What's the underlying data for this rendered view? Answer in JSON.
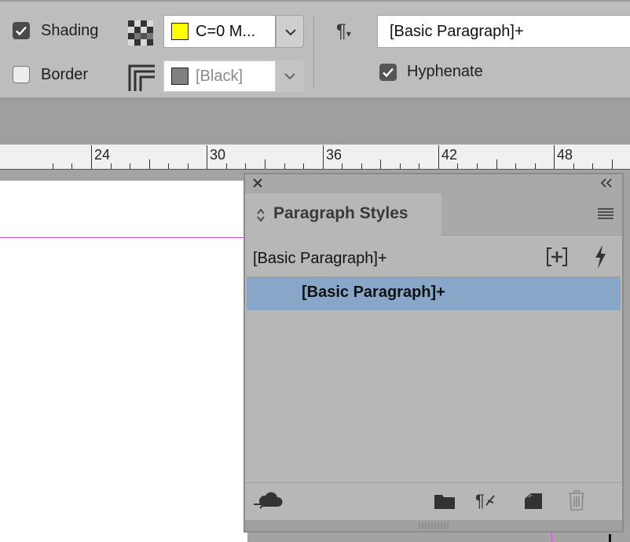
{
  "control_bar": {
    "shading": {
      "label": "Shading",
      "checked": true,
      "swatch_value": "C=0 M...",
      "swatch_color": "#ffff00"
    },
    "border": {
      "label": "Border",
      "checked": false,
      "swatch_value": "[Black]",
      "swatch_color": "#808080"
    },
    "paragraph_style_value": "[Basic Paragraph]+",
    "hyphenate": {
      "label": "Hyphenate",
      "checked": true
    }
  },
  "ruler": {
    "labels": [
      "24",
      "30",
      "36",
      "42",
      "48"
    ]
  },
  "panel": {
    "title": "Paragraph Styles",
    "current_style": "[Basic Paragraph]+",
    "styles": [
      {
        "label": "[Basic Paragraph]+",
        "selected": true
      }
    ],
    "icons": {
      "close": "close-icon",
      "collapse": "double-chevron-left-icon",
      "menu": "hamburger-menu-icon",
      "new_style": "new-style-icon",
      "quick_apply": "lightning-icon",
      "cc_libraries": "cloud-library-icon",
      "new_group": "folder-icon",
      "clear_overrides": "clear-overrides-icon",
      "create_style": "new-item-icon",
      "delete": "trash-icon"
    }
  },
  "colors": {
    "selection": "#88a6c8",
    "guide": "#d24fd2"
  }
}
